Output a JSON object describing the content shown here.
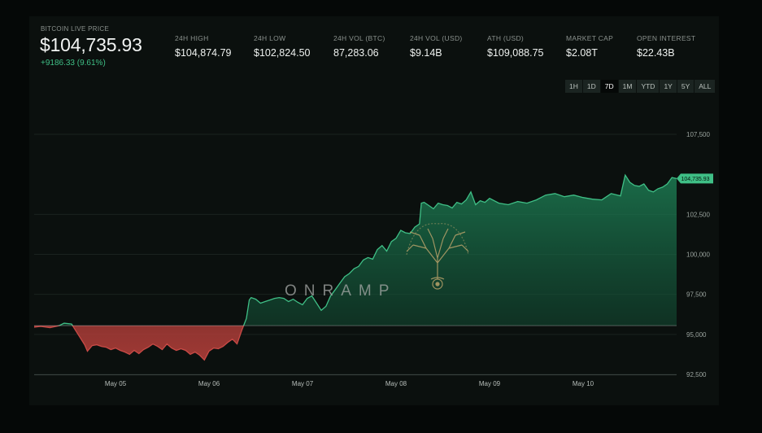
{
  "header": {
    "live_label": "BITCOIN LIVE PRICE",
    "price": "$104,735.93",
    "change": "+9186.33 (9.61%)"
  },
  "stats": [
    {
      "label": "24H HIGH",
      "value": "$104,874.79"
    },
    {
      "label": "24H LOW",
      "value": "$102,824.50"
    },
    {
      "label": "24H VOL (BTC)",
      "value": "87,283.06"
    },
    {
      "label": "24H VOL (USD)",
      "value": "$9.14B"
    },
    {
      "label": "ATH (USD)",
      "value": "$109,088.75"
    },
    {
      "label": "MARKET CAP",
      "value": "$2.08T"
    },
    {
      "label": "OPEN INTEREST",
      "value": "$22.43B"
    }
  ],
  "ranges": [
    {
      "label": "1H",
      "active": false
    },
    {
      "label": "1D",
      "active": false
    },
    {
      "label": "7D",
      "active": true
    },
    {
      "label": "1M",
      "active": false
    },
    {
      "label": "YTD",
      "active": false
    },
    {
      "label": "1Y",
      "active": false
    },
    {
      "label": "5Y",
      "active": false
    },
    {
      "label": "ALL",
      "active": false
    }
  ],
  "colors": {
    "up": "#3fbf86",
    "down": "#c94a46",
    "background": "#0b100e"
  },
  "watermark": {
    "text": "ONRAMP"
  },
  "chart_data": {
    "type": "area",
    "y_ticks": [
      "107,500",
      "102,500",
      "100,000",
      "97,500",
      "95,000",
      "92,500"
    ],
    "y_tick_values": [
      107500,
      102500,
      100000,
      97500,
      95000,
      92500
    ],
    "ylim": [
      92500,
      107500
    ],
    "x_ticks": [
      "May 05",
      "May 06",
      "May 07",
      "May 08",
      "May 09",
      "May 10"
    ],
    "x_tick_values": [
      1,
      2,
      3,
      4,
      5,
      6
    ],
    "xlim": [
      0.13,
      7.0
    ],
    "baseline": 95549.6,
    "current_price_label": "104,735.93",
    "current_price": 104735.93,
    "x": [
      0.13,
      0.2,
      0.3,
      0.4,
      0.45,
      0.53,
      0.6,
      0.67,
      0.7,
      0.75,
      0.8,
      0.85,
      0.9,
      0.95,
      1.0,
      1.05,
      1.1,
      1.15,
      1.2,
      1.25,
      1.3,
      1.35,
      1.4,
      1.45,
      1.5,
      1.55,
      1.6,
      1.65,
      1.7,
      1.75,
      1.8,
      1.85,
      1.9,
      1.95,
      2.0,
      2.05,
      2.1,
      2.15,
      2.2,
      2.25,
      2.3,
      2.35,
      2.4,
      2.43,
      2.45,
      2.5,
      2.55,
      2.6,
      2.65,
      2.7,
      2.75,
      2.8,
      2.85,
      2.9,
      2.95,
      3.0,
      3.05,
      3.1,
      3.15,
      3.2,
      3.25,
      3.3,
      3.35,
      3.4,
      3.45,
      3.5,
      3.55,
      3.6,
      3.65,
      3.7,
      3.75,
      3.8,
      3.85,
      3.9,
      3.95,
      4.0,
      4.05,
      4.1,
      4.15,
      4.2,
      4.25,
      4.27,
      4.3,
      4.35,
      4.4,
      4.45,
      4.5,
      4.55,
      4.6,
      4.65,
      4.7,
      4.75,
      4.8,
      4.85,
      4.9,
      4.95,
      5.0,
      5.1,
      5.2,
      5.3,
      5.4,
      5.5,
      5.6,
      5.7,
      5.8,
      5.9,
      6.0,
      6.1,
      6.2,
      6.3,
      6.4,
      6.45,
      6.5,
      6.55,
      6.6,
      6.65,
      6.7,
      6.75,
      6.8,
      6.85,
      6.9,
      6.95,
      7.0
    ],
    "y": [
      95450,
      95500,
      95420,
      95550,
      95700,
      95650,
      95000,
      94350,
      93950,
      94300,
      94350,
      94250,
      94200,
      94050,
      94150,
      94000,
      93900,
      93750,
      94000,
      93800,
      94050,
      94200,
      94400,
      94250,
      94050,
      94400,
      94150,
      94000,
      94100,
      94000,
      93750,
      93900,
      93700,
      93400,
      93950,
      94150,
      94100,
      94250,
      94500,
      94700,
      94400,
      95250,
      96000,
      97150,
      97300,
      97200,
      96950,
      97050,
      97150,
      97250,
      97300,
      97250,
      97050,
      97200,
      97000,
      96850,
      97250,
      97400,
      96950,
      96500,
      96750,
      97400,
      97800,
      98200,
      98600,
      98800,
      99100,
      99250,
      99650,
      99800,
      99700,
      100300,
      100550,
      100200,
      100800,
      101000,
      101500,
      101350,
      101300,
      101700,
      101900,
      103200,
      103250,
      103050,
      102850,
      103200,
      103100,
      103050,
      102900,
      103250,
      103150,
      103400,
      103900,
      103100,
      103350,
      103250,
      103500,
      103200,
      103100,
      103300,
      103200,
      103400,
      103700,
      103800,
      103600,
      103700,
      103550,
      103450,
      103400,
      103800,
      103650,
      104950,
      104500,
      104300,
      104250,
      104400,
      104000,
      103900,
      104100,
      104200,
      104400,
      104800,
      104736
    ]
  }
}
